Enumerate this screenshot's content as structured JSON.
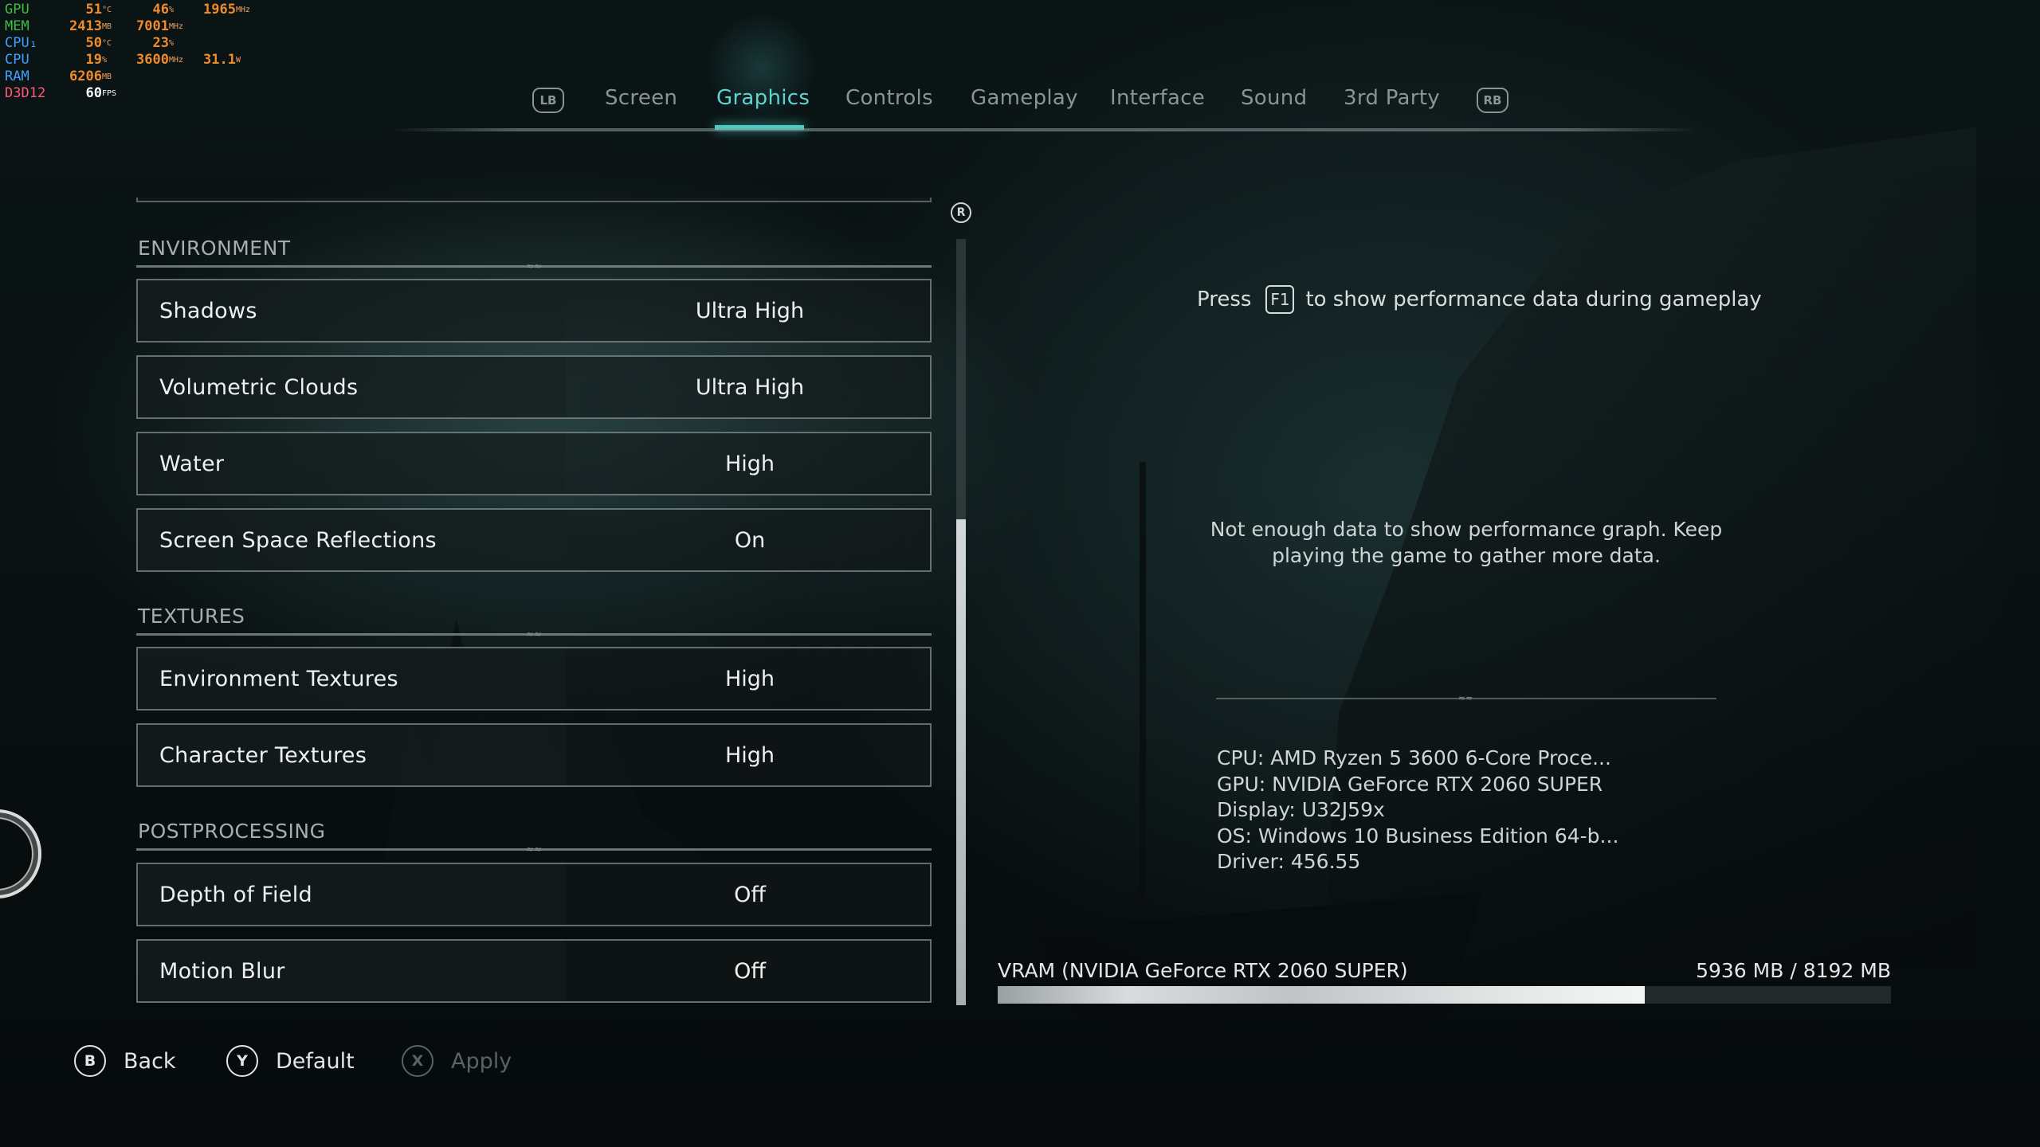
{
  "hud": {
    "rows": [
      {
        "label": "GPU",
        "label_color": "#3fbf3f",
        "v1": "51",
        "u1": "°C",
        "v2": "46",
        "u2": "%",
        "v3": "1965",
        "u3": "MHz"
      },
      {
        "label": "MEM",
        "label_color": "#3fbf3f",
        "v1": "2413",
        "u1": "MB",
        "v2": "7001",
        "u2": "MHz",
        "v3": "",
        "u3": ""
      },
      {
        "label": "CPU₁",
        "label_color": "#3fa0ff",
        "v1": "50",
        "u1": "°C",
        "v2": "23",
        "u2": "%",
        "v3": "",
        "u3": ""
      },
      {
        "label": "CPU",
        "label_color": "#3fa0ff",
        "v1": "19",
        "u1": "%",
        "v2": "3600",
        "u2": "MHz",
        "v3": "31.1",
        "u3": "W"
      },
      {
        "label": "RAM",
        "label_color": "#3fa0ff",
        "v1": "6206",
        "u1": "MB",
        "v2": "",
        "u2": "",
        "v3": "",
        "u3": ""
      },
      {
        "label": "D3D12",
        "label_color": "#ff5a7a",
        "v1": "60",
        "u1": "FPS",
        "v2": "",
        "u2": "",
        "v3": "",
        "u3": ""
      }
    ]
  },
  "tabs": {
    "lb": "LB",
    "rb": "RB",
    "items": [
      "Screen",
      "Graphics",
      "Controls",
      "Gameplay",
      "Interface",
      "Sound",
      "3rd Party"
    ],
    "active": "Graphics"
  },
  "sections": {
    "environment": "ENVIRONMENT",
    "textures": "TEXTURES",
    "postprocessing": "POSTPROCESSING"
  },
  "settings": [
    {
      "label": "Shadows",
      "value": "Ultra High"
    },
    {
      "label": "Volumetric Clouds",
      "value": "Ultra High"
    },
    {
      "label": "Water",
      "value": "High"
    },
    {
      "label": "Screen Space Reflections",
      "value": "On"
    },
    {
      "label": "Environment Textures",
      "value": "High"
    },
    {
      "label": "Character Textures",
      "value": "High"
    },
    {
      "label": "Depth of Field",
      "value": "Off"
    },
    {
      "label": "Motion Blur",
      "value": "Off"
    }
  ],
  "scroll_key": "R",
  "info": {
    "hint_pre": "Press",
    "hint_key": "F1",
    "hint_post": "to show performance data during gameplay",
    "perf_msg": "Not enough data to show performance graph. Keep playing the game to gather more data.",
    "system": [
      "CPU: AMD Ryzen 5 3600 6-Core Proce...",
      "GPU: NVIDIA GeForce RTX 2060 SUPER",
      "Display: U32J59x",
      "OS: Windows 10 Business Edition 64-b...",
      "Driver: 456.55"
    ],
    "vram_label": "VRAM (NVIDIA GeForce RTX 2060 SUPER)",
    "vram_value": "5936 MB / 8192 MB",
    "vram_used_mb": 5936,
    "vram_total_mb": 8192
  },
  "actions": {
    "back_key": "B",
    "back": "Back",
    "default_key": "Y",
    "default": "Default",
    "apply_key": "X",
    "apply": "Apply"
  }
}
